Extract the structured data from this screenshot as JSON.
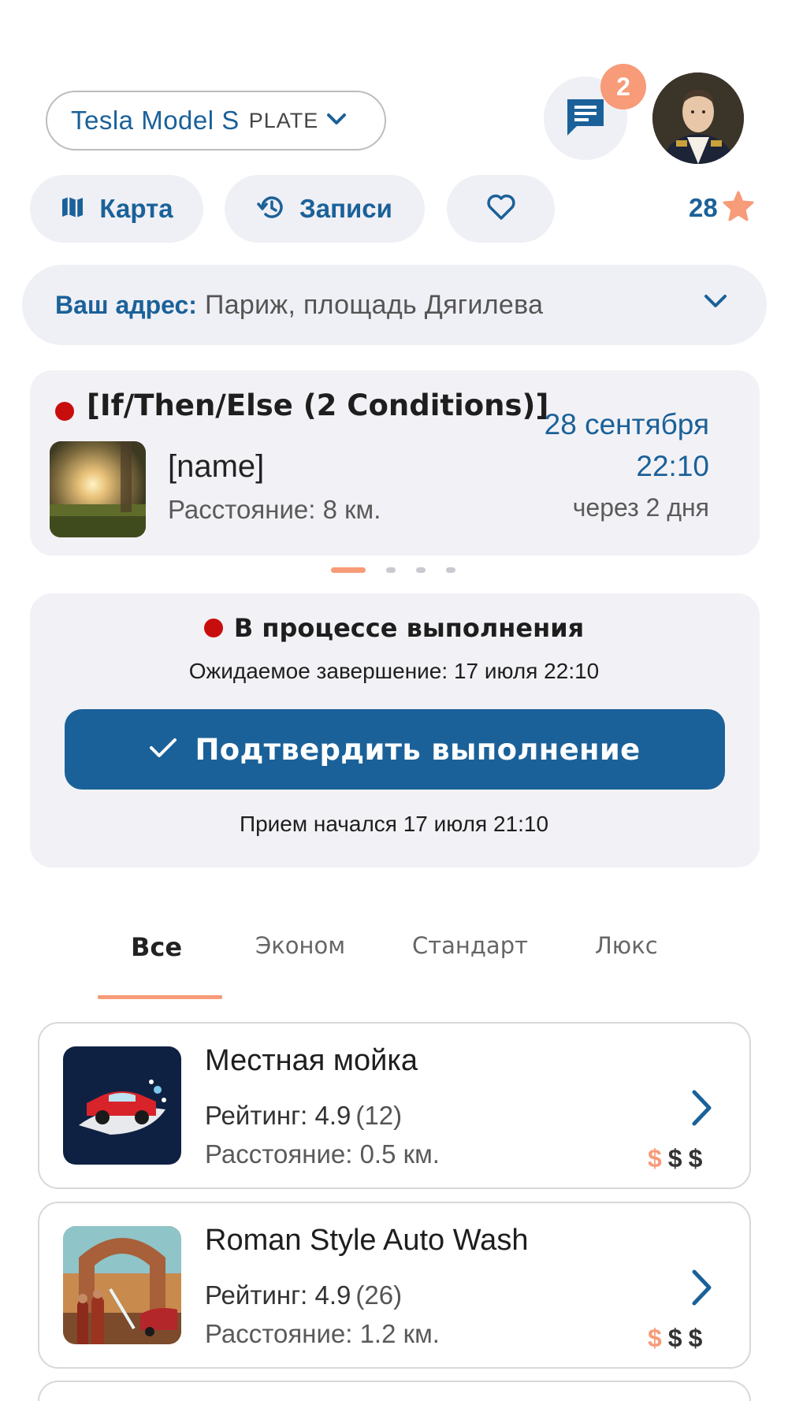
{
  "header": {
    "car_name": "Tesla Model S",
    "car_plate": "PLATE",
    "chat_badge": "2",
    "points": "28"
  },
  "actions": {
    "map_label": "Карта",
    "records_label": "Записи"
  },
  "address": {
    "label": "Ваш адрес:",
    "value": "Париж, площадь Дягилева"
  },
  "booking": {
    "title": "[If/Then/Else (2 Conditions)]",
    "name": "[name]",
    "distance": "Расстояние: 8 км.",
    "date": "28 сентября",
    "time": "22:10",
    "relative": "через 2 дня",
    "carousel_count": 4,
    "carousel_active": 0
  },
  "progress": {
    "status": "В процессе выполнения",
    "eta": "Ожидаемое завершение: 17 июля 22:10",
    "confirm_label": "Подтвердить выполнение",
    "started": "Прием начался 17 июля 21:10"
  },
  "tabs": [
    {
      "label": "Все",
      "active": true
    },
    {
      "label": "Эконом",
      "active": false
    },
    {
      "label": "Стандарт",
      "active": false
    },
    {
      "label": "Люкс",
      "active": false
    }
  ],
  "shops": [
    {
      "name": "Местная мойка",
      "rating_label": "Рейтинг:",
      "rating": "4.9",
      "reviews": "(12)",
      "distance": "Расстояние: 0.5 км.",
      "price_level": 1,
      "price_max": 3
    },
    {
      "name": "Roman Style Auto Wash",
      "rating_label": "Рейтинг:",
      "rating": "4.9",
      "reviews": "(26)",
      "distance": "Расстояние: 1.2 км.",
      "price_level": 1,
      "price_max": 3
    }
  ],
  "colors": {
    "primary": "#1b6199",
    "accent": "#f79b78",
    "card_bg": "#f2f2f6",
    "status_red": "#c80d0d"
  },
  "icons": {
    "car_select": "chevron-down-icon",
    "chat": "chat-icon",
    "map": "map-icon",
    "records": "history-icon",
    "favorites": "heart-icon",
    "points": "star-icon",
    "address": "chevron-down-icon",
    "confirm": "check-icon",
    "shop_open": "chevron-right-icon"
  }
}
